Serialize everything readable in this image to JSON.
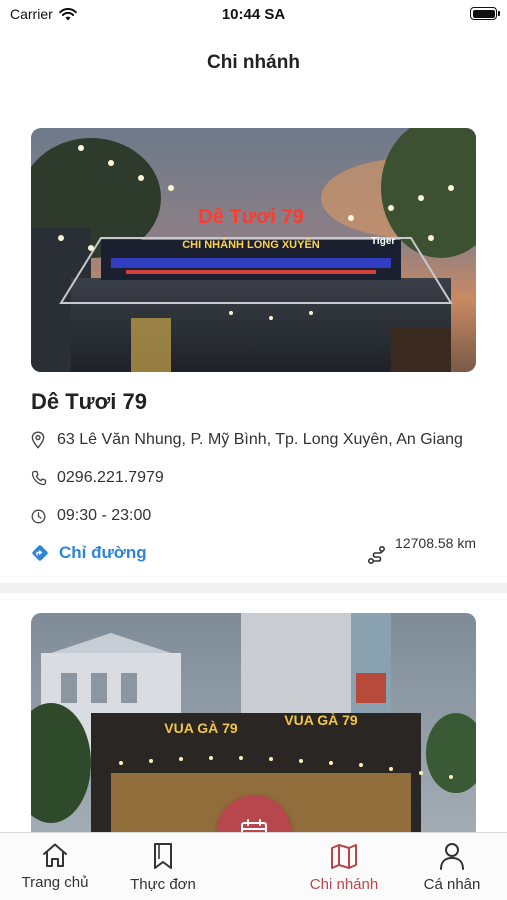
{
  "status_bar": {
    "carrier": "Carrier",
    "time": "10:44 SA"
  },
  "header": {
    "title": "Chi nhánh"
  },
  "branches": [
    {
      "name": "Dê Tươi 79",
      "address": "63 Lê Văn Nhung, P. Mỹ Bình, Tp. Long Xuyên, An Giang",
      "phone": "0296.221.7979",
      "hours": "09:30 - 23:00",
      "directions_label": "Chỉ đường",
      "distance": "12708.58 km",
      "sign_text": "Dê Tươi 79",
      "sign_subtext": "CHI NHÁNH LONG XUYÊN",
      "sign_brand": "Tiger"
    },
    {
      "sign_text": "VUA GÀ 79"
    }
  ],
  "tabbar": {
    "items": [
      {
        "label": "Trang chủ",
        "icon": "home-icon"
      },
      {
        "label": "Thực đơn",
        "icon": "bookmark-icon"
      },
      {
        "label": "Chi nhánh",
        "icon": "map-icon"
      },
      {
        "label": "Cá nhân",
        "icon": "person-icon"
      }
    ],
    "center_icon": "calendar-icon"
  },
  "colors": {
    "accent": "#b8474d",
    "link": "#2f86d6"
  }
}
